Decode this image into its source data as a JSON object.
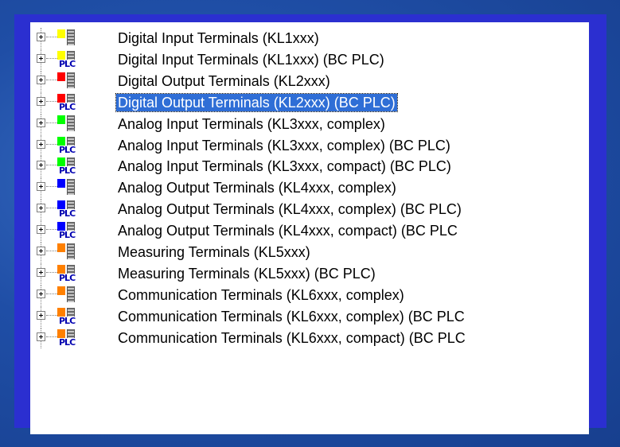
{
  "tree": {
    "items": [
      {
        "label": "Digital Input Terminals (KL1xxx)",
        "color": "#ffff00",
        "plc": false,
        "selected": false
      },
      {
        "label": "Digital Input Terminals (KL1xxx) (BC PLC)",
        "color": "#ffff00",
        "plc": true,
        "selected": false
      },
      {
        "label": "Digital Output Terminals (KL2xxx)",
        "color": "#ff0000",
        "plc": false,
        "selected": false
      },
      {
        "label": "Digital Output Terminals (KL2xxx) (BC PLC)",
        "color": "#ff0000",
        "plc": true,
        "selected": true
      },
      {
        "label": "Analog Input Terminals (KL3xxx, complex)",
        "color": "#00ff00",
        "plc": false,
        "selected": false
      },
      {
        "label": "Analog Input Terminals (KL3xxx, complex) (BC PLC)",
        "color": "#00ff00",
        "plc": true,
        "selected": false
      },
      {
        "label": "Analog Input Terminals (KL3xxx, compact) (BC PLC)",
        "color": "#00ff00",
        "plc": true,
        "selected": false
      },
      {
        "label": "Analog Output Terminals (KL4xxx, complex)",
        "color": "#0000ff",
        "plc": false,
        "selected": false
      },
      {
        "label": "Analog Output Terminals (KL4xxx, complex) (BC PLC)",
        "color": "#0000ff",
        "plc": true,
        "selected": false
      },
      {
        "label": "Analog Output Terminals (KL4xxx, compact) (BC PLC",
        "color": "#0000ff",
        "plc": true,
        "selected": false
      },
      {
        "label": "Measuring Terminals (KL5xxx)",
        "color": "#ff8000",
        "plc": false,
        "selected": false
      },
      {
        "label": "Measuring Terminals (KL5xxx) (BC PLC)",
        "color": "#ff8000",
        "plc": true,
        "selected": false
      },
      {
        "label": "Communication Terminals (KL6xxx, complex)",
        "color": "#ff8000",
        "plc": false,
        "selected": false
      },
      {
        "label": "Communication Terminals (KL6xxx, complex) (BC PLC",
        "color": "#ff8000",
        "plc": true,
        "selected": false
      },
      {
        "label": "Communication Terminals (KL6xxx, compact) (BC PLC",
        "color": "#ff8000",
        "plc": true,
        "selected": false
      }
    ],
    "plc_text": "PLC"
  }
}
